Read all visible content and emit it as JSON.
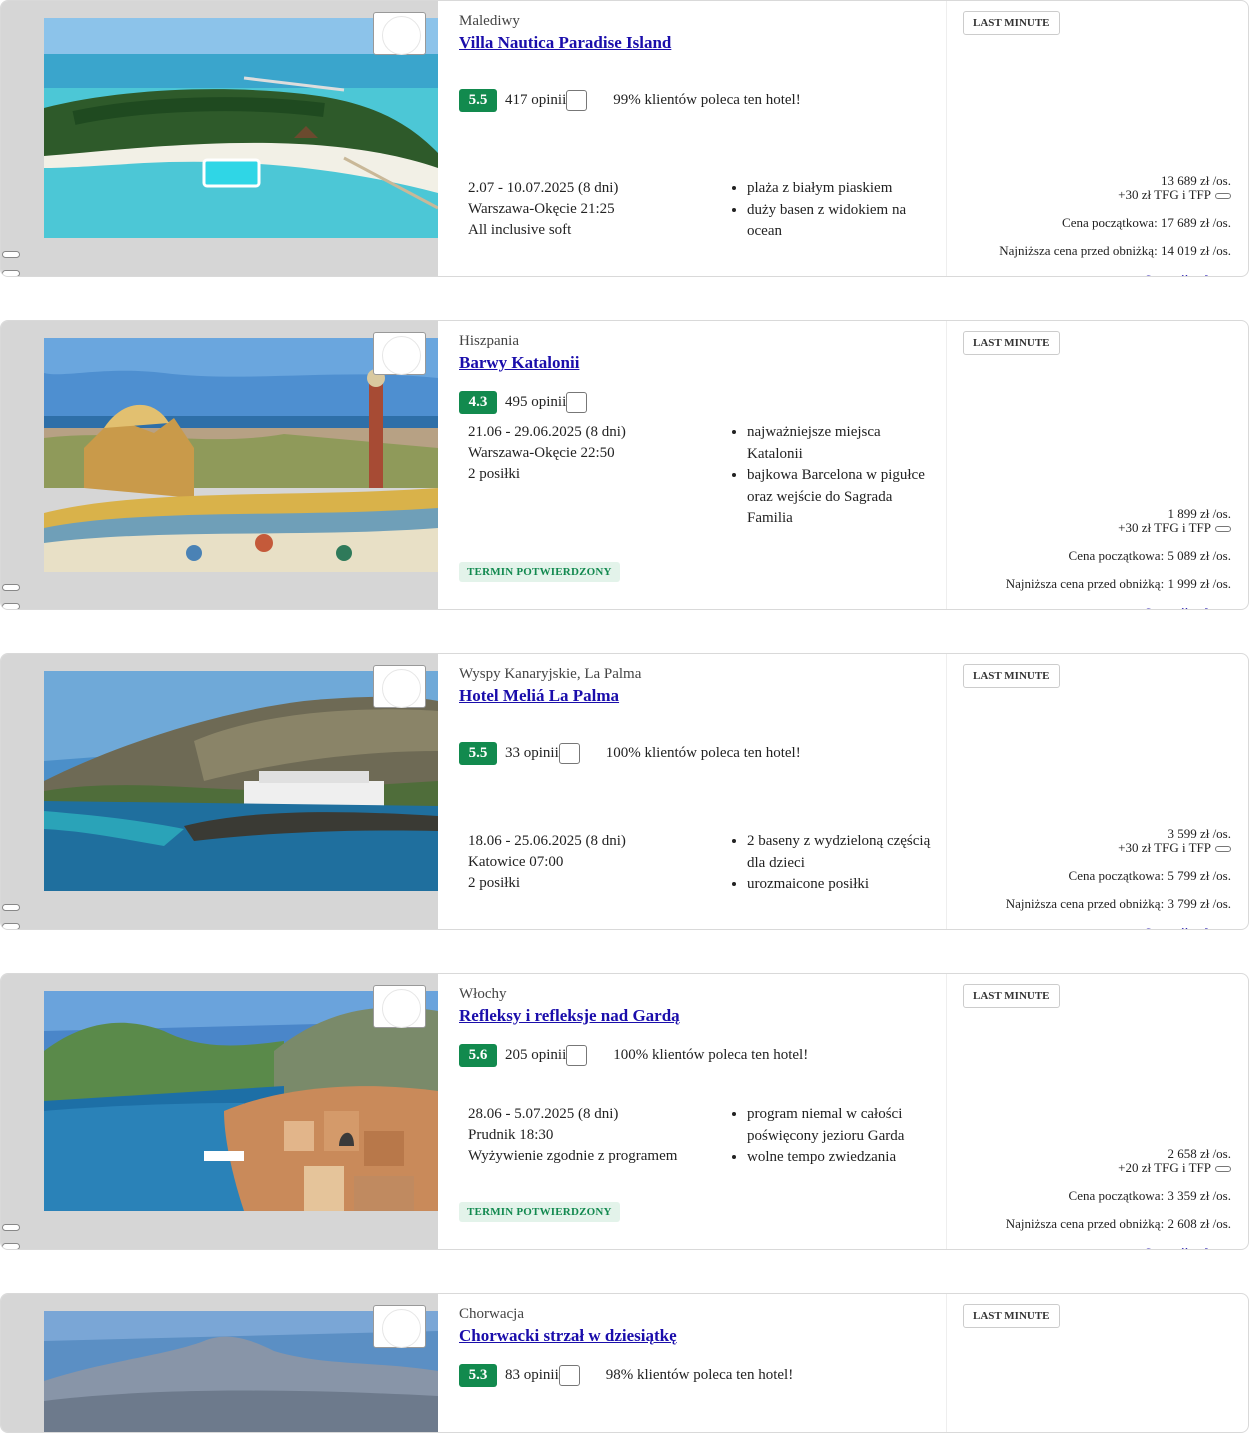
{
  "badge_last_minute": "LAST MINUTE",
  "badge_confirmed": "TERMIN POTWIERDZONY",
  "cut_link": "Szczegóły oferty",
  "colors": {
    "score_bg": "#128a4e",
    "link": "#1a0dab",
    "confirmed_bg": "#e3f3ea",
    "confirmed_text": "#12894f",
    "image_column_bg": "#d6d6d6"
  },
  "offers": [
    {
      "country": "Malediwy",
      "name": "Villa Nautica Paradise Island",
      "score": "5.5",
      "opinions": "417 opinii",
      "recommend": "99% klientów poleca ten hotel!",
      "dates": "2.07 - 10.07.2025 (8 dni)",
      "departure": "Warszawa-Okęcie 21:25",
      "board": "All inclusive soft",
      "features": [
        "plaża z białym piaskiem",
        "duży basen z widokiem na ocean"
      ],
      "price": "13 689 zł /os.",
      "tfg": "+30 zł TFG i TFP",
      "old_price": "Cena początkowa: 17 689 zł /os.",
      "lowest_price": "Najniższa cena przed obniżką: 14 019 zł /os."
    },
    {
      "country": "Hiszpania",
      "name": "Barwy Katalonii",
      "score": "4.3",
      "opinions": "495 opinii",
      "recommend": "",
      "dates": "21.06 - 29.06.2025 (8 dni)",
      "departure": "Warszawa-Okęcie 22:50",
      "board": "2 posiłki",
      "features": [
        "najważniejsze miejsca Katalonii",
        "bajkowa Barcelona w pigułce oraz wejście do Sagrada Familia"
      ],
      "price": "1 899 zł /os.",
      "tfg": "+30 zł TFG i TFP",
      "old_price": "Cena początkowa: 5 089 zł /os.",
      "lowest_price": "Najniższa cena przed obniżką: 1 999 zł /os."
    },
    {
      "country": "Wyspy Kanaryjskie, La Palma",
      "name": "Hotel Meliá La Palma",
      "score": "5.5",
      "opinions": "33 opinii",
      "recommend": "100% klientów poleca ten hotel!",
      "dates": "18.06 - 25.06.2025 (8 dni)",
      "departure": "Katowice 07:00",
      "board": "2 posiłki",
      "features": [
        "2 baseny z wydzieloną częścią dla dzieci",
        "urozmaicone posiłki"
      ],
      "price": "3 599 zł /os.",
      "tfg": "+30 zł TFG i TFP",
      "old_price": "Cena początkowa: 5 799 zł /os.",
      "lowest_price": "Najniższa cena przed obniżką: 3 799 zł /os."
    },
    {
      "country": "Włochy",
      "name": "Refleksy i refleksje nad Gardą",
      "score": "5.6",
      "opinions": "205 opinii",
      "recommend": "100% klientów poleca ten hotel!",
      "dates": "28.06 - 5.07.2025 (8 dni)",
      "departure": "Prudnik 18:30",
      "board": "Wyżywienie zgodnie z programem",
      "features": [
        "program niemal w całości poświęcony jezioru Garda",
        "wolne tempo zwiedzania"
      ],
      "price": "2 658 zł /os.",
      "tfg": "+20 zł TFG i TFP",
      "old_price": "Cena początkowa: 3 359 zł /os.",
      "lowest_price": "Najniższa cena przed obniżką: 2 608 zł /os."
    },
    {
      "country": "Chorwacja",
      "name": "Chorwacki strzał w dziesiątkę",
      "score": "5.3",
      "opinions": "83 opinii",
      "recommend": "98% klientów poleca ten hotel!"
    }
  ]
}
